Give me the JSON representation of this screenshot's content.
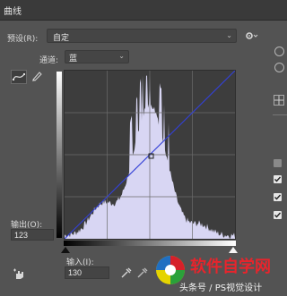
{
  "window": {
    "title": "曲线"
  },
  "preset": {
    "label": "预设(R):",
    "value": "自定"
  },
  "channel": {
    "label": "通道:",
    "value": "蓝"
  },
  "output": {
    "label": "输出(O):",
    "value": "123"
  },
  "input": {
    "label": "输入(I):",
    "value": "130"
  },
  "watermark": {
    "logo_text": "软件自学网",
    "sub_text": "头条号 / PS视觉设计"
  },
  "colors": {
    "curve": "#3340d6",
    "histogram": "#d8d6f3",
    "graph_bg": "#3d3d3d"
  }
}
